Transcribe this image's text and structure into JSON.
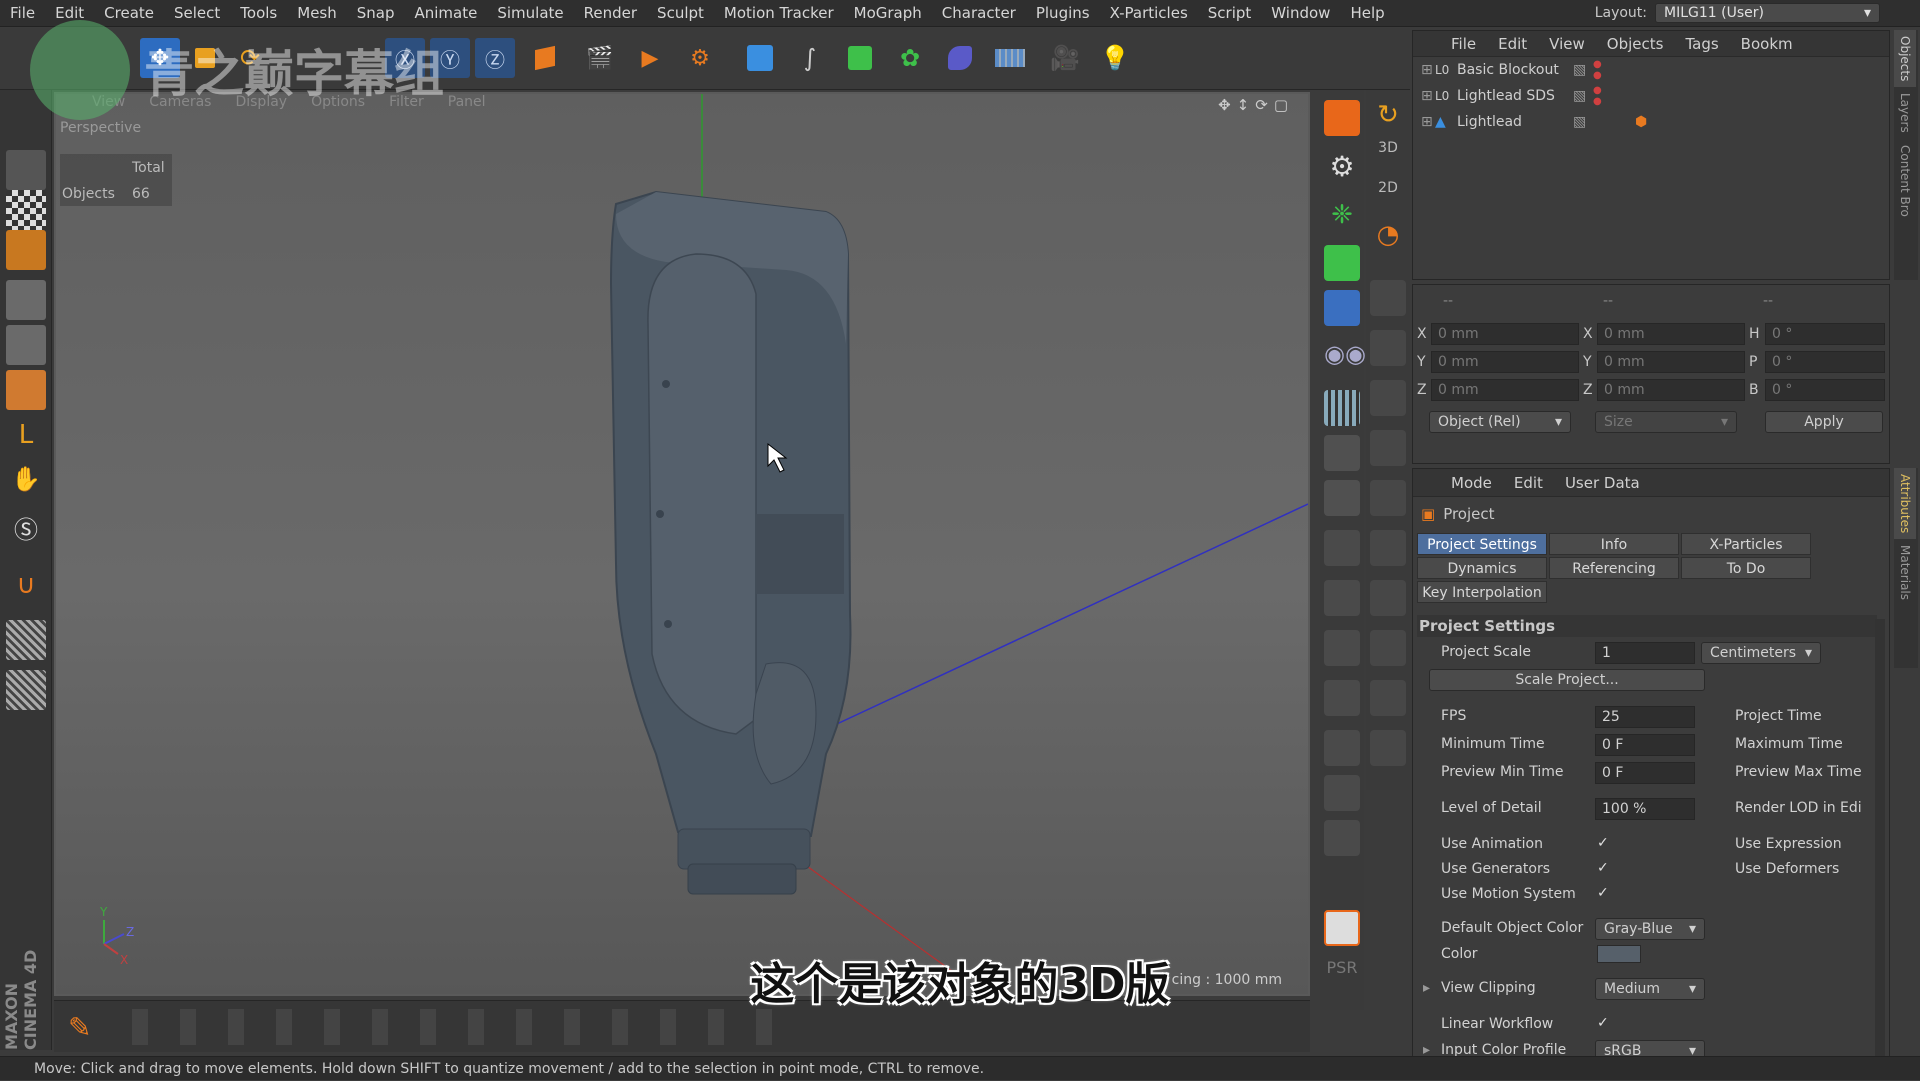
{
  "menubar": {
    "items": [
      "File",
      "Edit",
      "Create",
      "Select",
      "Tools",
      "Mesh",
      "Snap",
      "Animate",
      "Simulate",
      "Render",
      "Sculpt",
      "Motion Tracker",
      "MoGraph",
      "Character",
      "Plugins",
      "X-Particles",
      "Script",
      "Window",
      "Help"
    ],
    "layout_label": "Layout:",
    "layout_value": "MILG11 (User)"
  },
  "watermark": {
    "text": "青之巅字幕组"
  },
  "viewport": {
    "menu": [
      "View",
      "Cameras",
      "Display",
      "Options",
      "Filter",
      "Panel"
    ],
    "camera": "Perspective",
    "stats_total": "Total",
    "stats_objects_label": "Objects",
    "stats_objects_value": "66",
    "grid_spacing": "cing : 1000 mm"
  },
  "subtitle": "这个是该对象的3D版",
  "status_bar": "Move: Click and drag to move elements. Hold down SHIFT to quantize movement / add to the selection in point mode, CTRL to remove.",
  "object_manager": {
    "menu": [
      "File",
      "Edit",
      "View",
      "Objects",
      "Tags",
      "Bookm"
    ],
    "objects": [
      {
        "name": "Basic Blockout"
      },
      {
        "name": "Lightlead SDS"
      },
      {
        "name": "Lightlead"
      }
    ]
  },
  "coord_manager": {
    "headers": [
      "--",
      "--",
      "--"
    ],
    "rows": [
      {
        "a": "X",
        "av": "0 mm",
        "b": "X",
        "bv": "0 mm",
        "c": "H",
        "cv": "0 °"
      },
      {
        "a": "Y",
        "av": "0 mm",
        "b": "Y",
        "bv": "0 mm",
        "c": "P",
        "cv": "0 °"
      },
      {
        "a": "Z",
        "av": "0 mm",
        "b": "Z",
        "bv": "0 mm",
        "c": "B",
        "cv": "0 °"
      }
    ],
    "mode_select": "Object (Rel)",
    "size_select": "Size",
    "apply": "Apply"
  },
  "attribute_manager": {
    "menu": [
      "Mode",
      "Edit",
      "User Data"
    ],
    "object_title": "Project",
    "tabs": [
      "Project Settings",
      "Info",
      "X-Particles",
      "Dynamics",
      "Referencing",
      "To Do",
      "Key Interpolation"
    ],
    "section_title": "Project Settings",
    "project_scale_label": "Project Scale",
    "project_scale_value": "1",
    "project_scale_unit": "Centimeters",
    "scale_project_button": "Scale Project...",
    "fields": [
      {
        "label": "FPS",
        "value": "25",
        "label2": "Project Time"
      },
      {
        "label": "Minimum Time",
        "value": "0 F",
        "label2": "Maximum Time"
      },
      {
        "label": "Preview Min Time",
        "value": "0 F",
        "label2": "Preview Max Time"
      },
      {
        "label": "Level of Detail",
        "value": "100 %",
        "label2": "Render LOD in Edi"
      }
    ],
    "checks": [
      {
        "label": "Use Animation",
        "value": "✓",
        "label2": "Use Expression"
      },
      {
        "label": "Use Generators",
        "value": "✓",
        "label2": "Use Deformers"
      },
      {
        "label": "Use Motion System",
        "value": "✓",
        "label2": ""
      }
    ],
    "default_color_label": "Default Object Color",
    "default_color_value": "Gray-Blue",
    "color_label": "Color",
    "view_clipping_label": "View Clipping",
    "view_clipping_value": "Medium",
    "linear_workflow_label": "Linear Workflow",
    "linear_workflow_value": "✓",
    "input_color_profile_label": "Input Color Profile",
    "input_color_profile_value": "sRGB"
  },
  "side_tabs": {
    "right_top": [
      "Objects",
      "Layers",
      "Content Bro"
    ],
    "right_bottom": [
      "Attributes",
      "Materials"
    ]
  },
  "brand_vertical": "MAXON CINEMA 4D",
  "colors": {
    "accent": "#4e6f9e",
    "orange": "#f07a1a",
    "green_icon": "#3ec04a",
    "blue_icon": "#3a8fe0"
  }
}
